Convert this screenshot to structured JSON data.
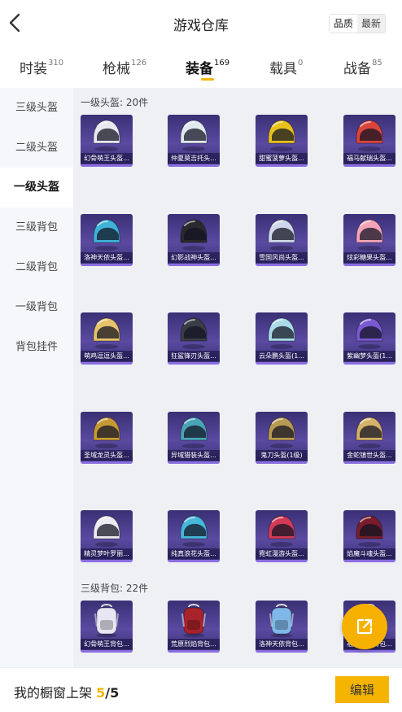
{
  "header": {
    "title": "游戏仓库",
    "sort": {
      "option_quality": "品质",
      "option_latest": "最新",
      "selected": "品质"
    }
  },
  "tabs": [
    {
      "label": "时装",
      "count": "310"
    },
    {
      "label": "枪械",
      "count": "126"
    },
    {
      "label": "装备",
      "count": "169",
      "active": true
    },
    {
      "label": "载具",
      "count": "0"
    },
    {
      "label": "战备",
      "count": "85"
    }
  ],
  "sidebar": {
    "items": [
      {
        "label": "三级头盔"
      },
      {
        "label": "二级头盔"
      },
      {
        "label": "一级头盔",
        "active": true
      },
      {
        "label": "三级背包"
      },
      {
        "label": "二级背包"
      },
      {
        "label": "一级背包"
      },
      {
        "label": "背包挂件"
      }
    ]
  },
  "sections": [
    {
      "title": "一级头盔: 20件",
      "items": [
        {
          "name": "幻骨萌王头盔...",
          "icon": "white-dragon-helmet",
          "color": "#e8e8f0"
        },
        {
          "name": "仲夏莫吉托头...",
          "icon": "mint-helmet",
          "color": "#dfe9ee"
        },
        {
          "name": "甜蜜菠萝头盔...",
          "icon": "pineapple-helmet",
          "color": "#e8c21a"
        },
        {
          "name": "福马献瑞头盔...",
          "icon": "red-green-helmet",
          "color": "#d9453b"
        },
        {
          "name": "洛神天依头盔...",
          "icon": "blue-white-helmet",
          "color": "#3fb2d8"
        },
        {
          "name": "幻影战神头盔...",
          "icon": "black-helmet",
          "color": "#2a2a2e"
        },
        {
          "name": "雪国风尚头盔...",
          "icon": "silver-blue-helmet",
          "color": "#cfd8ea"
        },
        {
          "name": "炫彩糖果头盔...",
          "icon": "candy-helmet",
          "color": "#f4a3b8"
        },
        {
          "name": "萌鸡逗逗头盔...",
          "icon": "chick-helmet",
          "color": "#e6c26a"
        },
        {
          "name": "狂鲨锋刃头盔...",
          "icon": "shark-helmet",
          "color": "#3a3d46"
        },
        {
          "name": "云朵鹏头盔(1...",
          "icon": "cloud-helmet",
          "color": "#a9dbe8"
        },
        {
          "name": "紫幽梦头盔(1...",
          "icon": "purple-helmet",
          "color": "#7a5ad0"
        },
        {
          "name": "圣域龙灵头盔...",
          "icon": "gold-dragon-helmet",
          "color": "#c59a35"
        },
        {
          "name": "异域猎装头盔...",
          "icon": "teal-pattern-helmet",
          "color": "#4aa4b6"
        },
        {
          "name": "鬼刀头盔(1级)",
          "icon": "ghost-blade-helmet",
          "color": "#b89a52"
        },
        {
          "name": "金蛇镇世头盔...",
          "icon": "golden-snake-helmet",
          "color": "#d4b26a"
        },
        {
          "name": "精灵梦叶罗丽...",
          "icon": "fairy-helmet",
          "color": "#eeeaf2"
        },
        {
          "name": "纯真浪花头盔...",
          "icon": "wave-helmet",
          "color": "#47b7da"
        },
        {
          "name": "霓虹漫游头盔...",
          "icon": "neon-helmet",
          "color": "#d23a58"
        },
        {
          "name": "焰魔斗魂头盔...",
          "icon": "flame-demon-helmet",
          "color": "#7a1c2a"
        }
      ]
    },
    {
      "title": "三级背包: 22件",
      "items": [
        {
          "name": "幻骨萌王背包...",
          "icon": "white-dragon-backpack",
          "color": "#e8e6f2"
        },
        {
          "name": "荒原烈焰背包...",
          "icon": "flame-backpack",
          "color": "#a8232b"
        },
        {
          "name": "洛神天依背包...",
          "icon": "blue-backpack",
          "color": "#7fb8e8"
        },
        {
          "name": "福马献瑞背包...",
          "icon": "red-backpack",
          "color": "#c94032"
        }
      ]
    }
  ],
  "fab": {
    "icon": "share-icon"
  },
  "footer": {
    "showcase_label": "我的橱窗上架",
    "showcase_current": "5",
    "showcase_sep": "/",
    "showcase_total": "5",
    "edit_label": "编辑"
  },
  "colors": {
    "accent": "#f5b400",
    "item_bg": "#4a3f8c",
    "content_bg": "#eef0f4"
  }
}
